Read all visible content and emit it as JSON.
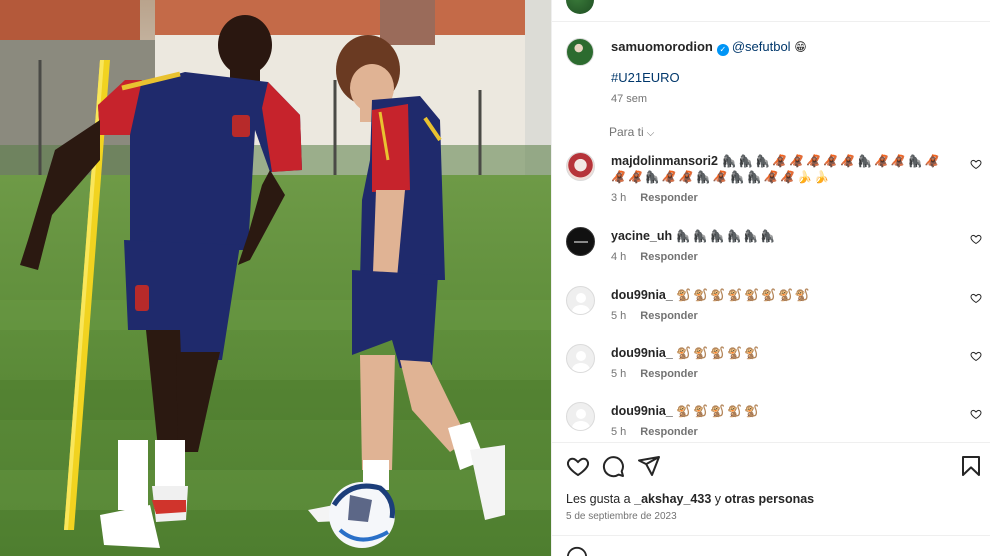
{
  "post": {
    "image_alt": "Two Spain U21 players training with a football on grass",
    "caption": {
      "username": "samuomorodion",
      "mention": "@sefutbol",
      "emoji": "😁",
      "hashtag": "#U21EURO",
      "age": "47 sem"
    },
    "filter_label": "Para ti",
    "reply_label": "Responder",
    "comments": [
      {
        "username": "majdolinmansori2",
        "text": "🦍🦍🦍🦧🦧🦧🦧🦧🦍🦧🦧🦍🦧🦧🦧🦍🦧🦧🦍🦧🦍🦍🦧🦧🍌🍌",
        "time": "3 h"
      },
      {
        "username": "yacine_uh",
        "text": "🦍🦍🦍🦍🦍🦍",
        "time": "4 h"
      },
      {
        "username": "dou99nia_",
        "text": "🐒🐒🐒🐒🐒🐒🐒🐒",
        "time": "5 h"
      },
      {
        "username": "dou99nia_",
        "text": "🐒🐒🐒🐒🐒",
        "time": "5 h"
      },
      {
        "username": "dou99nia_",
        "text": "🐒🐒🐒🐒🐒",
        "time": "5 h"
      }
    ],
    "likes": {
      "prefix": "Les gusta a",
      "user": "_akshay_433",
      "conj": "y",
      "others": "otras personas"
    },
    "date": "5 de septiembre de 2023"
  },
  "icons": {
    "verified": "verified-badge-icon",
    "like": "heart-icon",
    "comment": "comment-bubble-icon",
    "share": "paper-plane-icon",
    "save": "bookmark-icon",
    "comment_like": "small-heart-icon"
  },
  "colors": {
    "link": "#00376b",
    "verified": "#0095f6",
    "muted": "#737373"
  }
}
